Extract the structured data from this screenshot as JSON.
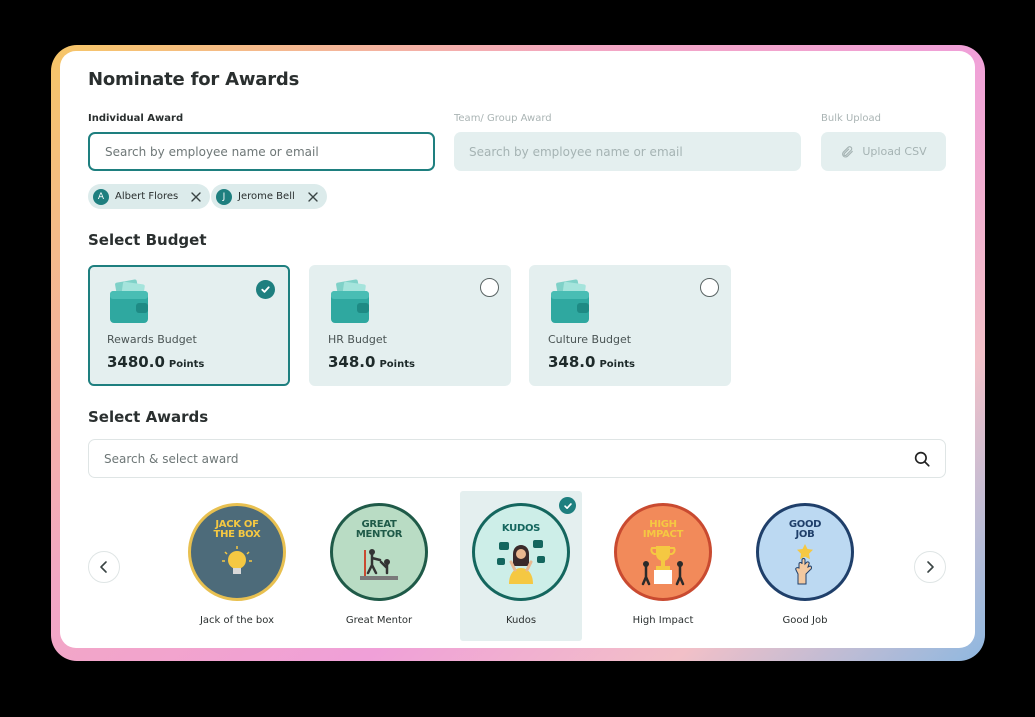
{
  "title": "Nominate for Awards",
  "individual": {
    "label": "Individual Award",
    "placeholder": "Search by employee name or email",
    "chips": [
      {
        "initial": "A",
        "name": "Albert Flores"
      },
      {
        "initial": "J",
        "name": "Jerome Bell"
      }
    ]
  },
  "team": {
    "label": "Team/ Group Award",
    "placeholder": "Search by employee name or email"
  },
  "bulk": {
    "label": "Bulk Upload",
    "button": "Upload CSV"
  },
  "budget": {
    "heading": "Select Budget",
    "unit": "Points",
    "items": [
      {
        "name": "Rewards Budget",
        "value": "3480.0",
        "selected": true
      },
      {
        "name": "HR Budget",
        "value": "348.0",
        "selected": false
      },
      {
        "name": "Culture Budget",
        "value": "348.0",
        "selected": false
      }
    ]
  },
  "awards": {
    "heading": "Select Awards",
    "search_placeholder": "Search & select award",
    "items": [
      {
        "badge_line1": "JACK OF",
        "badge_line2": "THE BOX",
        "name": "Jack of the box",
        "bg": "#4d6b7a",
        "ring": "#e8c050",
        "text": "#f5c842",
        "selected": false
      },
      {
        "badge_line1": "GREAT",
        "badge_line2": "MENTOR",
        "name": "Great Mentor",
        "bg": "#b9dcc4",
        "ring": "#1f5a48",
        "text": "#1f5a48",
        "selected": false
      },
      {
        "badge_line1": "KUDOS",
        "badge_line2": "",
        "name": "Kudos",
        "bg": "#cdeee8",
        "ring": "#14665e",
        "text": "#14665e",
        "selected": true
      },
      {
        "badge_line1": "HIGH",
        "badge_line2": "IMPACT",
        "name": "High Impact",
        "bg": "#f28a5a",
        "ring": "#c94a30",
        "text": "#f5c842",
        "selected": false
      },
      {
        "badge_line1": "GOOD",
        "badge_line2": "JOB",
        "name": "Good Job",
        "bg": "#bcd9f2",
        "ring": "#1f3f6a",
        "text": "#1f3f6a",
        "selected": false
      }
    ]
  },
  "colors": {
    "accent": "#1e7f7f",
    "soft": "#e4efef"
  }
}
